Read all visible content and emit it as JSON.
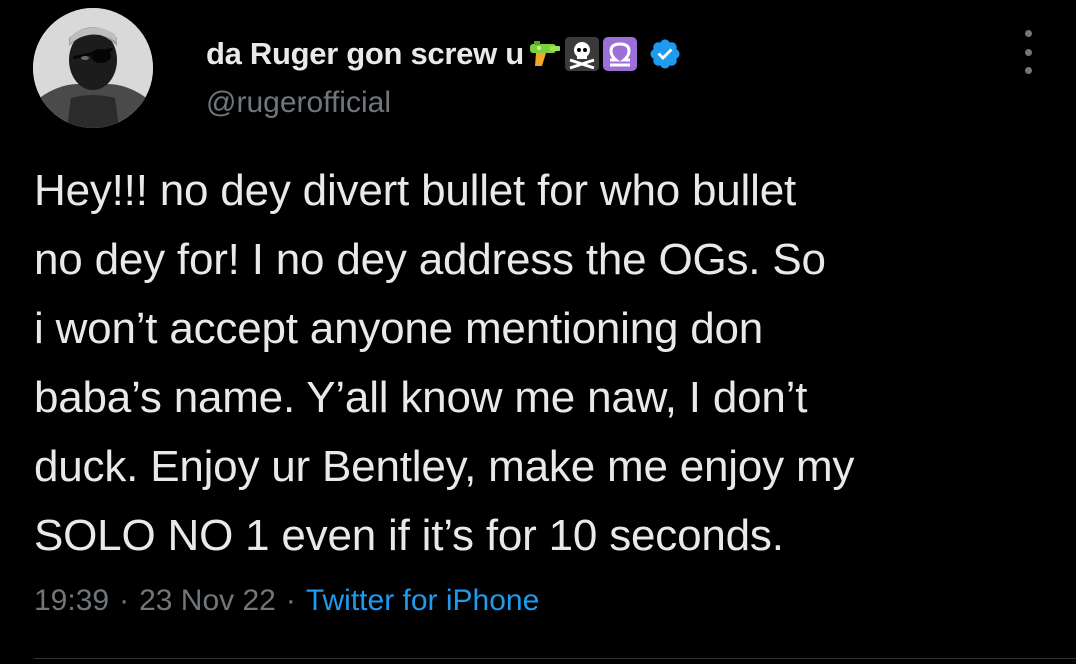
{
  "user": {
    "display_name": "da Ruger gon screw u",
    "handle": "@rugerofficial",
    "emojis": [
      "water-pistol-icon",
      "skull-crossbones-icon",
      "libra-icon"
    ],
    "verified": true
  },
  "tweet": {
    "lines": [
      "Hey!!! no dey divert bullet for who bullet",
      "no dey for! I no dey address the OGs. So",
      "i won’t accept anyone mentioning don",
      "baba’s name. Y’all know me naw, I don’t",
      "duck. Enjoy ur Bentley, make me enjoy my",
      "SOLO NO 1 even if it’s for 10 seconds."
    ]
  },
  "meta": {
    "time": "19:39",
    "separator": "·",
    "date": "23 Nov 22",
    "source": "Twitter for iPhone"
  },
  "colors": {
    "background": "#000000",
    "text": "#e7e9ea",
    "secondary": "#71767b",
    "accent": "#1d9bf0"
  }
}
